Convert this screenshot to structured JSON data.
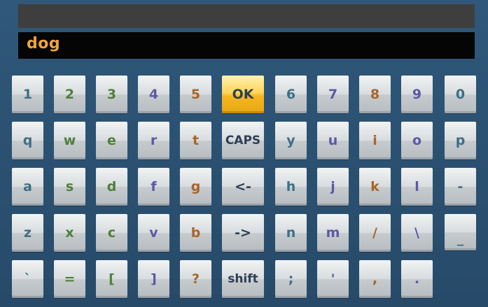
{
  "title_bar": {
    "text": ""
  },
  "input": {
    "value": "dog"
  },
  "keyboard": {
    "selected_key": "OK",
    "rows": [
      [
        "1",
        "2",
        "3",
        "4",
        "5",
        "OK",
        "6",
        "7",
        "8",
        "9",
        "0"
      ],
      [
        "q",
        "w",
        "e",
        "r",
        "t",
        "CAPS",
        "y",
        "u",
        "i",
        "o",
        "p"
      ],
      [
        "a",
        "s",
        "d",
        "f",
        "g",
        "<-",
        "h",
        "j",
        "k",
        "l",
        "-"
      ],
      [
        "z",
        "x",
        "c",
        "v",
        "b",
        "->",
        "n",
        "m",
        "/",
        "\\",
        "_"
      ],
      [
        "`",
        "=",
        "[",
        "]",
        "?",
        "shift",
        ";",
        "'",
        ",",
        "."
      ]
    ]
  },
  "colors": {
    "background": "#2a4f6e",
    "title_bar": "#3e3e3e",
    "input_bar": "#050505",
    "input_text": "#f0a43a",
    "selected_key": "#f5b621"
  }
}
